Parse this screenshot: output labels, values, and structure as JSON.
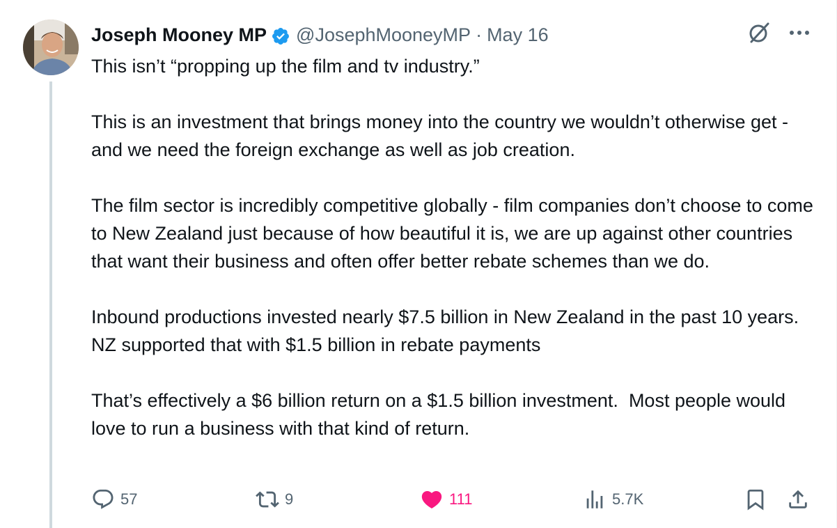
{
  "author": {
    "name": "Joseph Mooney MP",
    "handle": "@JosephMooneyMP",
    "separator": "·",
    "date": "May 16"
  },
  "body": {
    "paragraphs": [
      "This isn’t “propping up the film and tv industry.”",
      "This is an investment that brings money into the country we wouldn’t otherwise get - and we need the foreign exchange as well as job creation.",
      "The film sector is incredibly competitive globally - film companies don’t choose to come to New Zealand just because of how beautiful it is, we are up against other countries that want their business and often offer better rebate schemes than we do.",
      "Inbound productions invested nearly $7.5 billion in New Zealand in the past 10 years.   NZ supported that with $1.5 billion in rebate payments",
      "That’s effectively a $6 billion return on a $1.5 billion investment.  Most people would love to run a business with that kind of return."
    ]
  },
  "metrics": {
    "replies": "57",
    "reposts": "9",
    "likes": "111",
    "views": "5.7K"
  },
  "icons": {
    "verified": "verified-badge-icon",
    "grok": "grok-icon",
    "more": "more-icon",
    "reply": "reply-icon",
    "repost": "repost-icon",
    "like": "heart-filled-icon",
    "views": "views-icon",
    "bookmark": "bookmark-icon",
    "share": "share-icon"
  },
  "colors": {
    "text": "#0f1419",
    "secondary": "#536471",
    "verified": "#1d9bf0",
    "like": "#f91880",
    "thread_line": "#cfd9de"
  }
}
